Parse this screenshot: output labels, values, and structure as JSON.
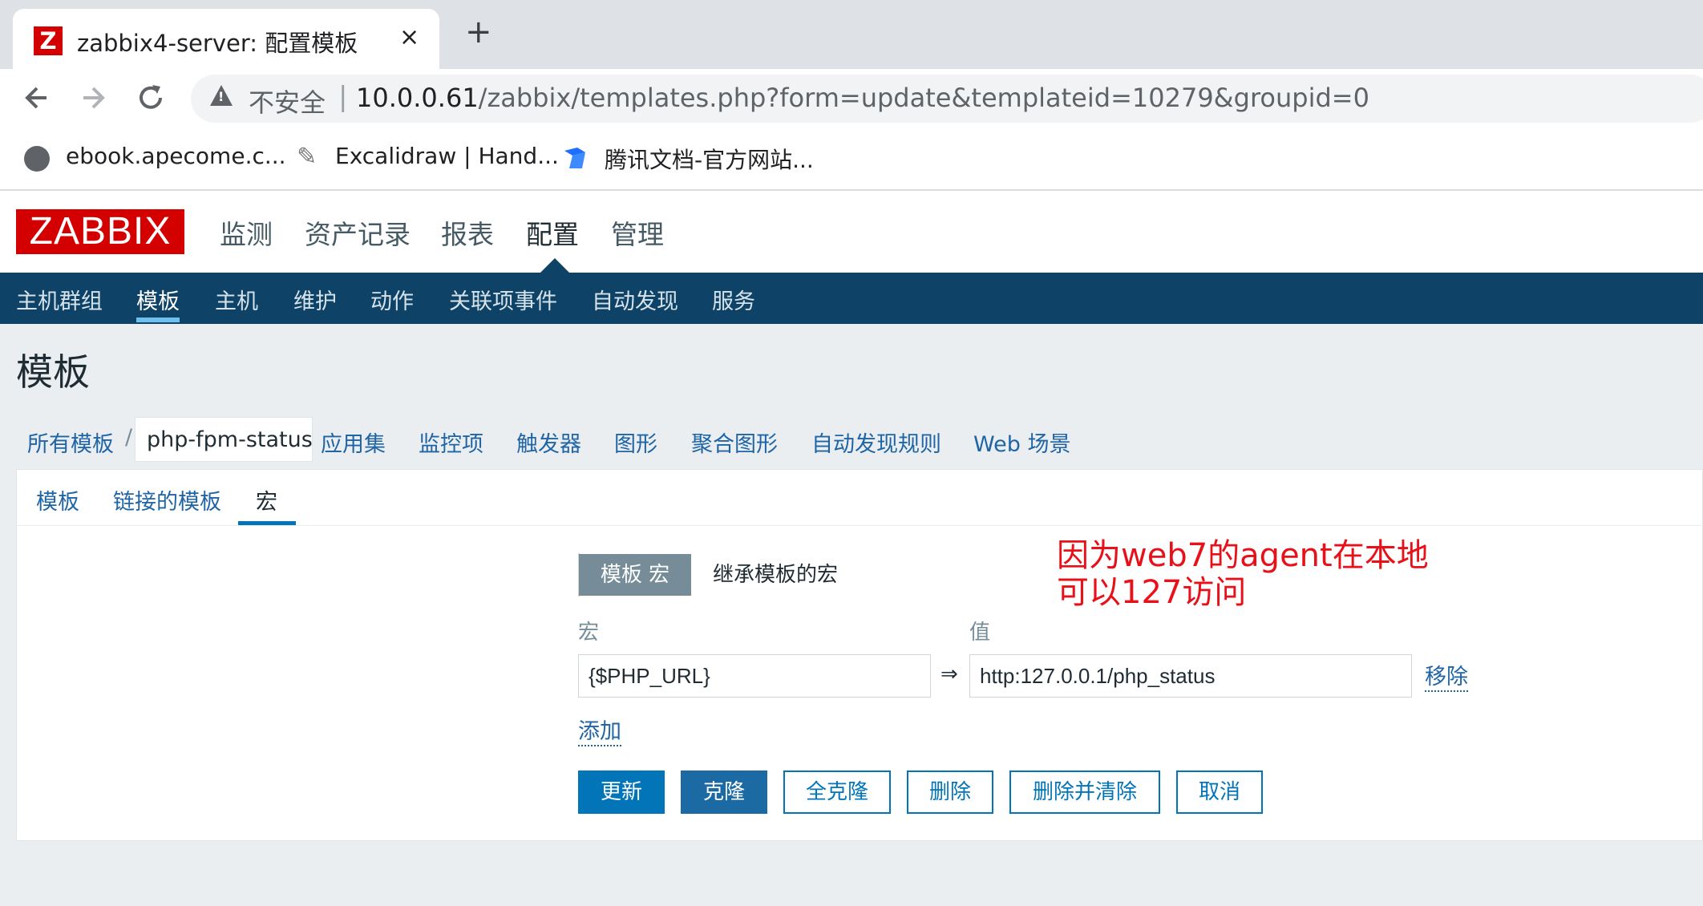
{
  "browser": {
    "tab_title": "zabbix4-server: 配置模板",
    "tab_close": "×",
    "new_tab": "+",
    "insecure_label": "不安全",
    "url_host": "10.0.0.61",
    "url_path": "/zabbix/templates.php?form=update&templateid=10279&groupid=0",
    "bookmarks": [
      "ebook.apecome.c...",
      "Excalidraw | Hand...",
      "腾讯文档-官方网站..."
    ]
  },
  "zabbix": {
    "logo": "ZABBIX",
    "main_menu": [
      "监测",
      "资产记录",
      "报表",
      "配置",
      "管理"
    ],
    "sub_menu": [
      "主机群组",
      "模板",
      "主机",
      "维护",
      "动作",
      "关联项事件",
      "自动发现",
      "服务"
    ],
    "page_title": "模板",
    "breadcrumbs": {
      "all_templates": "所有模板",
      "separator": "/",
      "current": "php-fpm-status",
      "links": [
        "应用集",
        "监控项",
        "触发器",
        "图形",
        "聚合图形",
        "自动发现规则",
        "Web 场景"
      ]
    },
    "form_tabs": [
      "模板",
      "链接的模板",
      "宏"
    ],
    "macro_toggle": {
      "active": "模板 宏",
      "inactive": "继承模板的宏"
    },
    "labels": {
      "macro": "宏",
      "value": "值"
    },
    "macro_row": {
      "macro": "{$PHP_URL}",
      "arrow": "⇒",
      "value": "http:127.0.0.1/php_status",
      "remove": "移除"
    },
    "add_link": "添加",
    "buttons": [
      "更新",
      "克隆",
      "全克隆",
      "删除",
      "删除并清除",
      "取消"
    ]
  },
  "annotation": {
    "line1": "因为web7的agent在本地",
    "line2": "可以127访问"
  },
  "colors": {
    "zabbix_red": "#d40000",
    "nav_blue": "#0e4367",
    "primary": "#0275b8",
    "annotation_red": "#e8111a"
  }
}
